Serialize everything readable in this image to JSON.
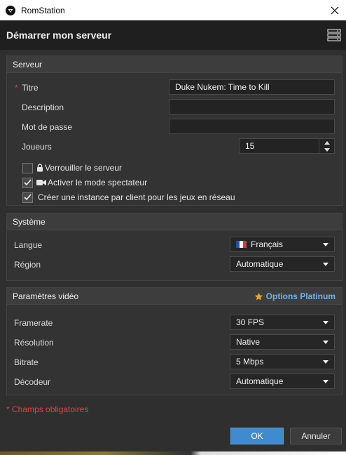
{
  "window": {
    "title": "RomStation"
  },
  "header": {
    "title": "Démarrer mon serveur"
  },
  "server": {
    "section_title": "Serveur",
    "required_mark": "*",
    "title_label": "Titre",
    "title_value": "Duke Nukem: Time to Kill",
    "description_label": "Description",
    "description_value": "",
    "password_label": "Mot de passe",
    "password_value": "",
    "players_label": "Joueurs",
    "players_value": "15",
    "lock_label": "Verrouiller le serveur",
    "lock_checked": false,
    "spectator_label": "Activer le mode spectateur",
    "spectator_checked": true,
    "instance_label": "Créer une instance par client pour les jeux en réseau",
    "instance_checked": true
  },
  "system": {
    "section_title": "Système",
    "language_label": "Langue",
    "language_value": "Français",
    "region_label": "Région",
    "region_value": "Automatique"
  },
  "video": {
    "section_title": "Paramètres vidéo",
    "platinum_label": "Options Platinum",
    "framerate_label": "Framerate",
    "framerate_value": "30 FPS",
    "resolution_label": "Résolution",
    "resolution_value": "Native",
    "bitrate_label": "Bitrate",
    "bitrate_value": "5 Mbps",
    "decoder_label": "Décodeur",
    "decoder_value": "Automatique"
  },
  "footer": {
    "required_note": "* Champs obligatoires",
    "ok_label": "OK",
    "cancel_label": "Annuler"
  },
  "colors": {
    "accent": "#3f8bd0",
    "required": "#e0414a",
    "platinum": "#6fb2ec",
    "star": "#e8a323"
  },
  "icons": [
    "app-logo-icon",
    "close-icon",
    "server-menu-icon",
    "lock-icon",
    "camera-icon",
    "star-icon",
    "flag-fr-icon",
    "chevron-down-icon",
    "spin-up-icon",
    "spin-down-icon",
    "checkmark-icon"
  ]
}
